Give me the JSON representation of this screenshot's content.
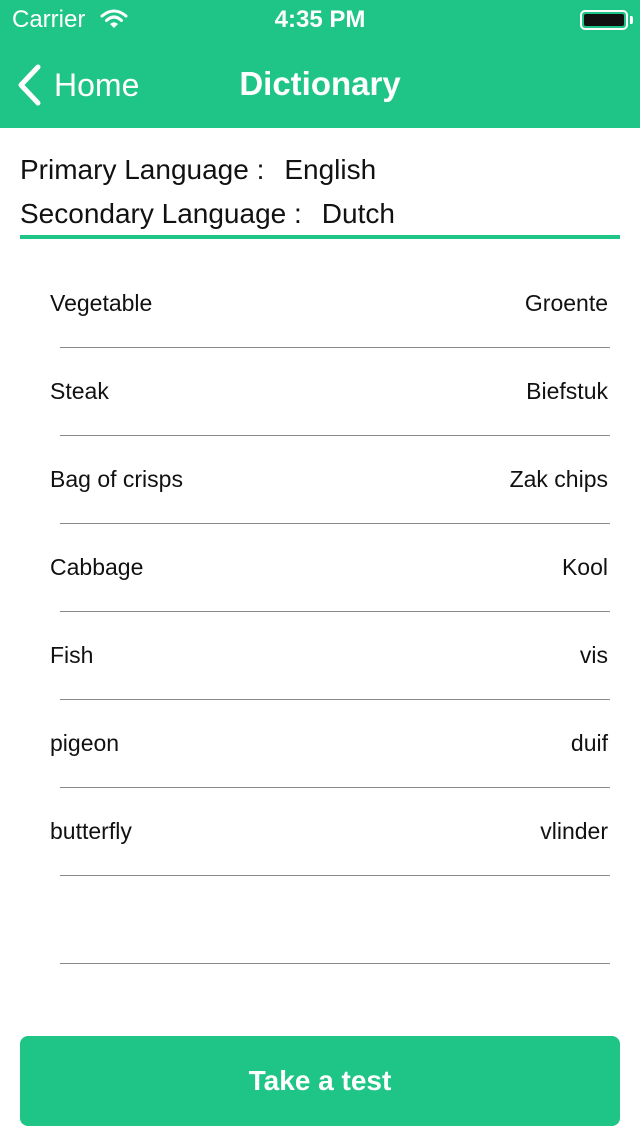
{
  "status_bar": {
    "carrier": "Carrier",
    "time": "4:35 PM",
    "wifi_icon": "wifi-icon",
    "battery_icon": "battery-icon",
    "battery_level": 1.0
  },
  "nav": {
    "back_label": "Home",
    "back_icon": "chevron-left-icon",
    "title": "Dictionary"
  },
  "languages": {
    "primary_label": "Primary Language :",
    "primary_value": "English",
    "secondary_label": "Secondary Language :",
    "secondary_value": "Dutch"
  },
  "words": [
    {
      "primary": "Vegetable",
      "secondary": "Groente"
    },
    {
      "primary": "Steak",
      "secondary": "Biefstuk"
    },
    {
      "primary": "Bag of crisps",
      "secondary": "Zak chips"
    },
    {
      "primary": "Cabbage",
      "secondary": "Kool"
    },
    {
      "primary": "Fish",
      "secondary": "vis"
    },
    {
      "primary": "pigeon",
      "secondary": "duif"
    },
    {
      "primary": "butterfly",
      "secondary": "vlinder"
    },
    {
      "primary": "",
      "secondary": ""
    }
  ],
  "actions": {
    "take_test_label": "Take a test"
  },
  "colors": {
    "accent": "#1fc586",
    "text": "#111111",
    "divider": "#8a8a8a"
  }
}
